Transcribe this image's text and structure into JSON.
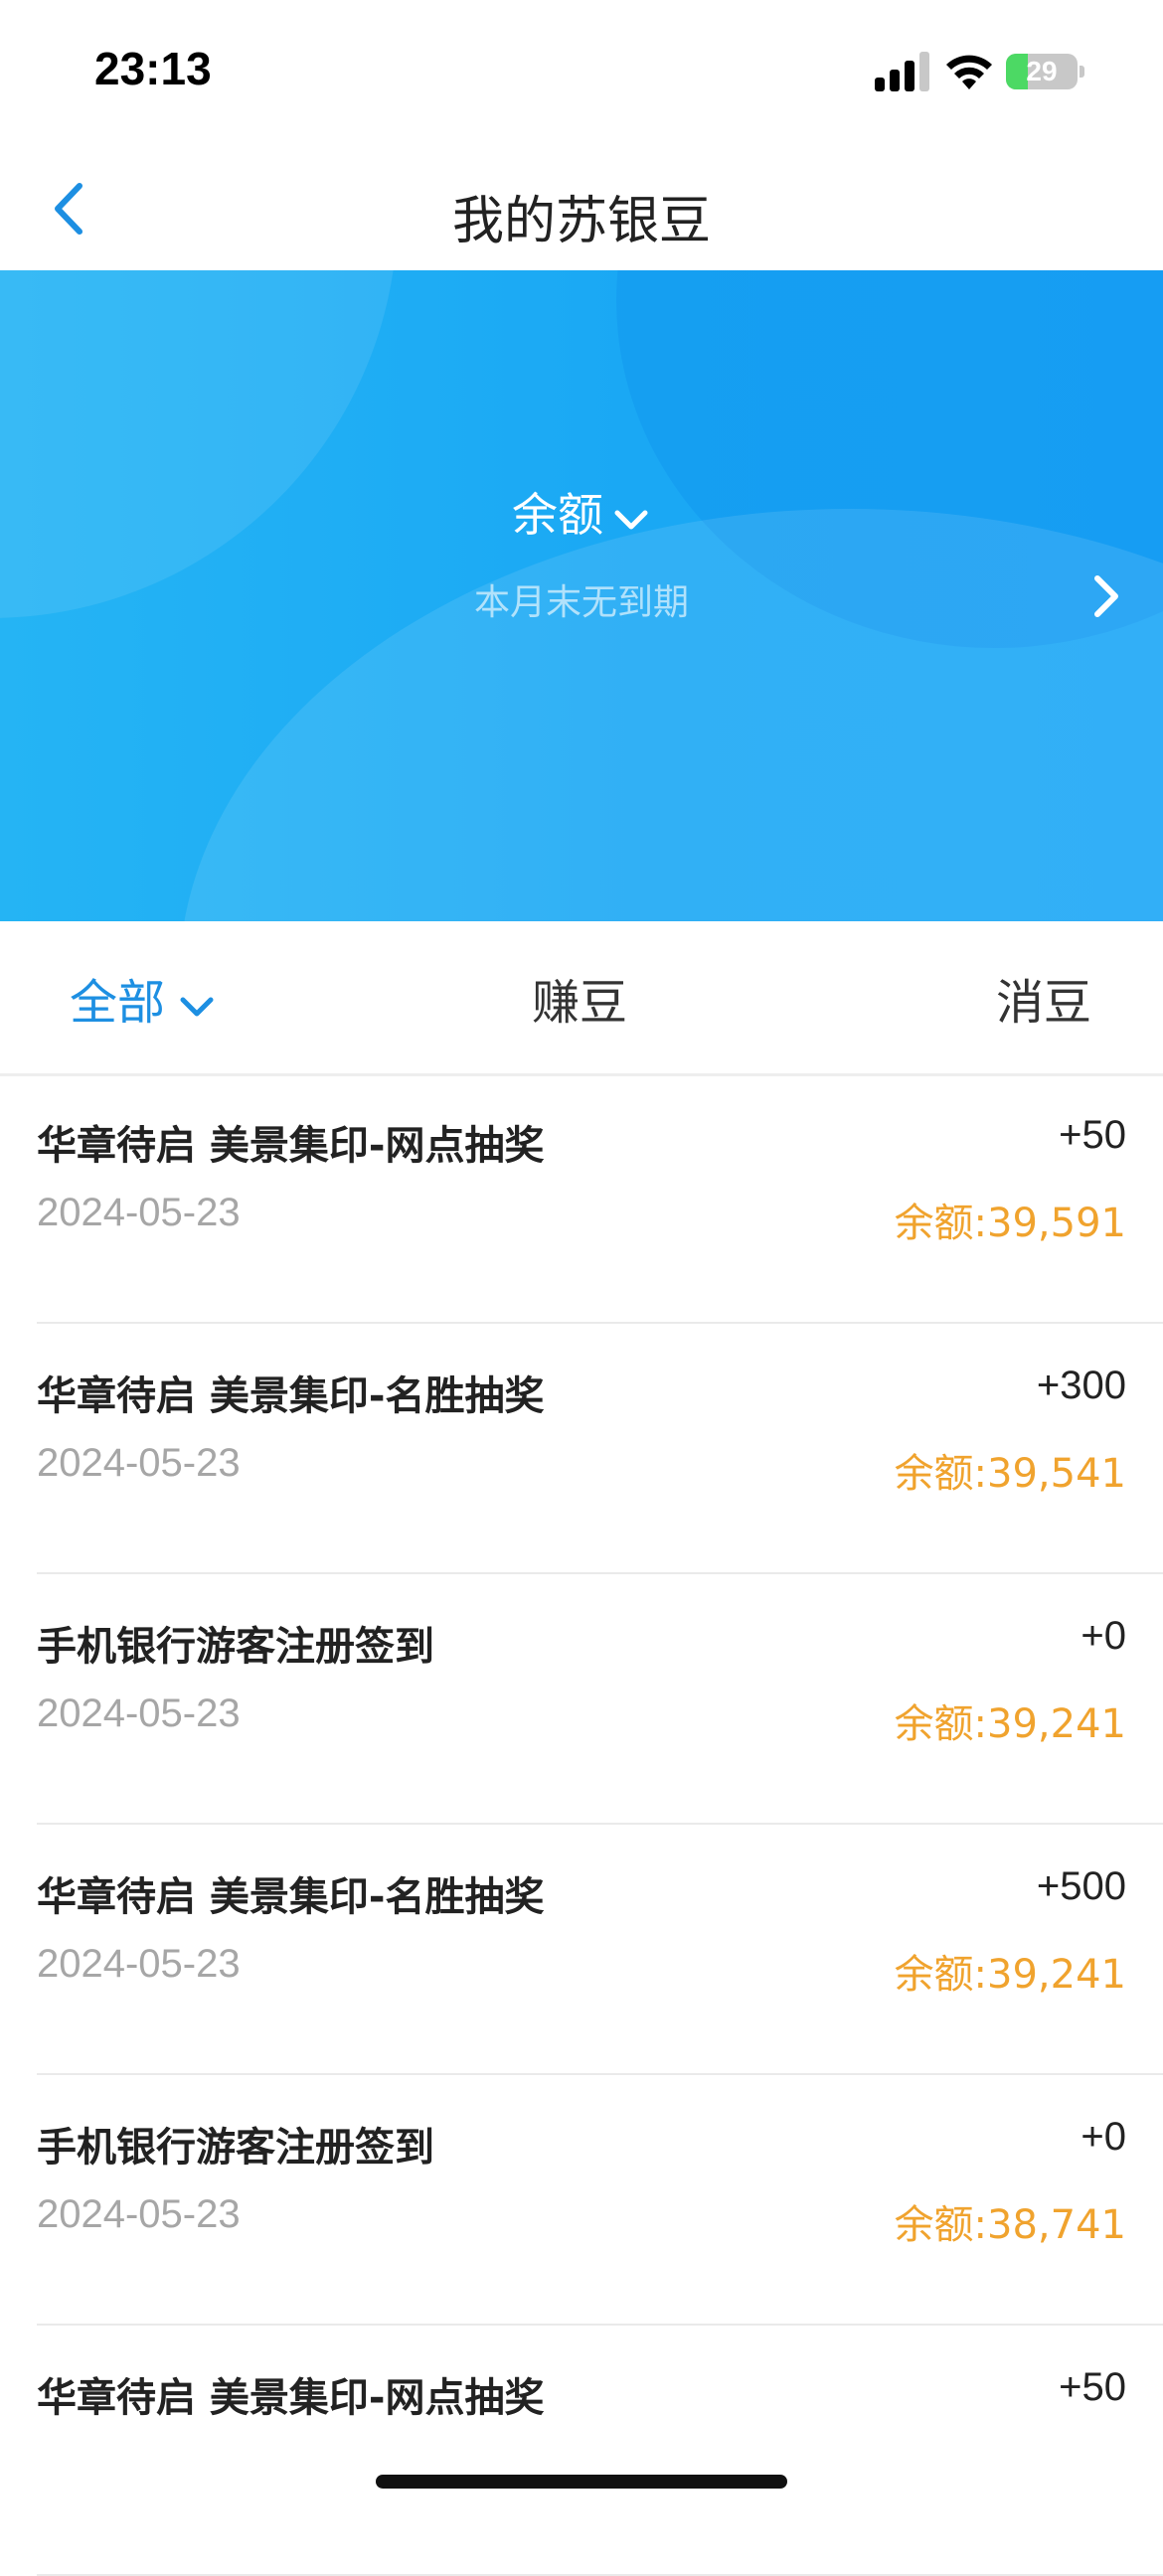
{
  "status_bar": {
    "time": "23:13",
    "battery": "29"
  },
  "nav": {
    "title": "我的苏银豆"
  },
  "hero": {
    "balance_label": "余额",
    "expiry_text": "本月末无到期"
  },
  "tabs": [
    {
      "label": "全部",
      "active": true
    },
    {
      "label": "赚豆",
      "active": false
    },
    {
      "label": "消豆",
      "active": false
    }
  ],
  "transactions": [
    {
      "title": "华章待启 美景集印-网点抽奖",
      "amount": "+50",
      "date": "2024-05-23",
      "balance": "余额:39,591"
    },
    {
      "title": "华章待启 美景集印-名胜抽奖",
      "amount": "+300",
      "date": "2024-05-23",
      "balance": "余额:39,541"
    },
    {
      "title": "手机银行游客注册签到",
      "amount": "+0",
      "date": "2024-05-23",
      "balance": "余额:39,241"
    },
    {
      "title": "华章待启 美景集印-名胜抽奖",
      "amount": "+500",
      "date": "2024-05-23",
      "balance": "余额:39,241"
    },
    {
      "title": "手机银行游客注册签到",
      "amount": "+0",
      "date": "2024-05-23",
      "balance": "余额:38,741"
    },
    {
      "title": "华章待启 美景集印-网点抽奖",
      "amount": "+50",
      "date": "",
      "balance": ""
    }
  ],
  "colors": {
    "accent": "#1d8fe2",
    "hero_blue": "#1aa8f4",
    "balance_orange": "#f0a32e",
    "date_gray": "#a6a6a6"
  }
}
